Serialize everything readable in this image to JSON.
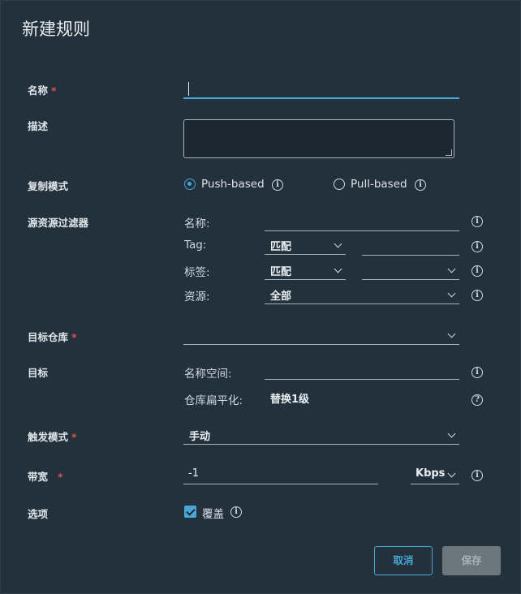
{
  "dialog": {
    "title": "新建规则"
  },
  "fields": {
    "name": {
      "label": "名称",
      "value": ""
    },
    "description": {
      "label": "描述"
    },
    "replication_mode": {
      "label": "复制模式",
      "options": [
        "Push-based",
        "Pull-based"
      ],
      "selected": "Push-based"
    },
    "source_filter": {
      "label": "源资源过滤器",
      "name_label": "名称:",
      "tag_label": "Tag:",
      "tag_match": "匹配",
      "label_label": "标签:",
      "label_match": "匹配",
      "resource_label": "资源:",
      "resource_value": "全部"
    },
    "dest_registry": {
      "label": "目标仓库"
    },
    "destination": {
      "label": "目标",
      "namespace_label": "名称空间:",
      "flatten_label": "仓库扁平化:",
      "flatten_value": "替换1级"
    },
    "trigger_mode": {
      "label": "触发模式",
      "value": "手动"
    },
    "bandwidth": {
      "label": "带宽",
      "value": "-1",
      "unit": "Kbps"
    },
    "options": {
      "label": "选项",
      "override_label": "覆盖",
      "override_checked": true
    }
  },
  "buttons": {
    "cancel": "取消",
    "save": "保存"
  },
  "colors": {
    "accent": "#49a7d8",
    "background": "#22313b",
    "required": "#d9534f"
  },
  "icons": {
    "info": "info-circle-icon",
    "help": "help-circle-icon",
    "chevron": "chevron-down-icon"
  }
}
